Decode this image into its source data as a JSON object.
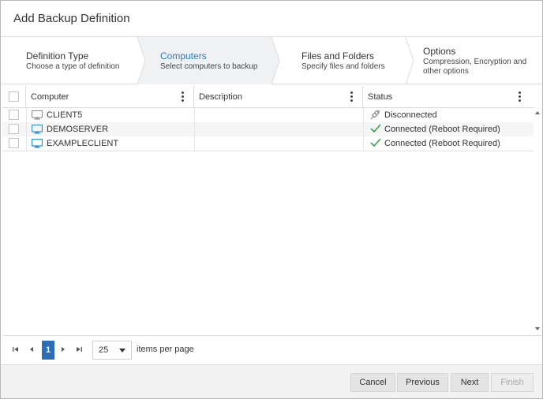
{
  "dialog": {
    "title": "Add Backup Definition"
  },
  "wizard": {
    "steps": [
      {
        "title": "Definition Type",
        "subtitle": "Choose a type of definition"
      },
      {
        "title": "Computers",
        "subtitle": "Select computers to backup"
      },
      {
        "title": "Files and Folders",
        "subtitle": "Specify files and folders"
      },
      {
        "title": "Options",
        "subtitle_line1": "Compression, Encryption and",
        "subtitle_line2": "other options"
      }
    ],
    "active_step": 1,
    "active_color": "#2d7bbf"
  },
  "grid": {
    "columns": [
      "Computer",
      "Description",
      "Status"
    ],
    "rows": [
      {
        "computer": "CLIENT5",
        "description": "",
        "status": "Disconnected",
        "status_icon": "unplugged-icon",
        "computer_icon": "monitor-grey-icon"
      },
      {
        "computer": "DEMOSERVER",
        "description": "",
        "status": "Connected (Reboot Required)",
        "status_icon": "checkmark-icon",
        "computer_icon": "monitor-blue-icon"
      },
      {
        "computer": "EXAMPLECLIENT",
        "description": "",
        "status": "Connected (Reboot Required)",
        "status_icon": "checkmark-icon",
        "computer_icon": "monitor-blue-icon"
      }
    ]
  },
  "pager": {
    "current_page": "1",
    "page_size": "25",
    "items_per_page_label": "items per page",
    "accent": "#2d6db5"
  },
  "footer": {
    "cancel": "Cancel",
    "previous": "Previous",
    "next": "Next",
    "finish": "Finish"
  }
}
